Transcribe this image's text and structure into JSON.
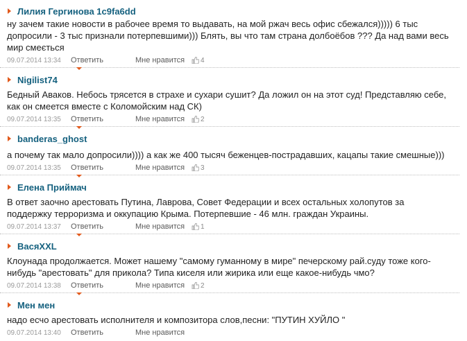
{
  "comments": [
    {
      "author": "Лилия Гергинова 1c9fa6dd",
      "text": "ну зачем такие новости в рабочее время то выдавать, на мой ржач весь офис сбежался))))) 6 тыс допросили - 3 тыс признали потерпевшими))) Блять, вы что там страна долбоёбов ??? Да над вами весь мир смеється",
      "date": "09.07.2014 13:34",
      "reply": "Ответить",
      "like": "Мне нравится",
      "likes": "4"
    },
    {
      "author": "Nigilist74",
      "text": "Бедный Аваков. Небось трясется в страхе и сухари сушит? Да ложил он на этот суд! Представляю себе, как он смеется вместе с Коломойским над СК)",
      "date": "09.07.2014 13:35",
      "reply": "Ответить",
      "like": "Мне нравится",
      "likes": "2"
    },
    {
      "author": "banderas_ghost",
      "text": "а почему так мало допросили)))) а как же 400 тысяч беженцев-пострадавших, кацапы такие смешные)))",
      "date": "09.07.2014 13:35",
      "reply": "Ответить",
      "like": "Мне нравится",
      "likes": "3"
    },
    {
      "author": "Елена Приймач",
      "text": "В ответ заочно арестовать Путина, Лаврова, Совет Федерации и всех остальных холопутов за поддержку терроризма и оккупацию Крыма. Потерпевшие - 46 млн. граждан Украины.",
      "date": "09.07.2014 13:37",
      "reply": "Ответить",
      "like": "Мне нравится",
      "likes": "1"
    },
    {
      "author": "ВасяXXL",
      "text": "Клоунада продолжается. Может нашему \"самому гуманному в мире\" печерскому рай.суду тоже кого-нибудь \"арестовать\" для прикола? Типа киселя или жирика или еще какое-нибудь чмо?",
      "date": "09.07.2014 13:38",
      "reply": "Ответить",
      "like": "Мне нравится",
      "likes": "2"
    },
    {
      "author": "Мен мен",
      "text": "надо есчо арестовать исполнителя и композитора слов,песни: \"ПУТИН ХУЙЛО \"",
      "date": "09.07.2014 13:40",
      "reply": "Ответить",
      "like": "Мне нравится",
      "likes": ""
    }
  ],
  "colors": {
    "accent": "#e25a1c",
    "author": "#15617f"
  }
}
